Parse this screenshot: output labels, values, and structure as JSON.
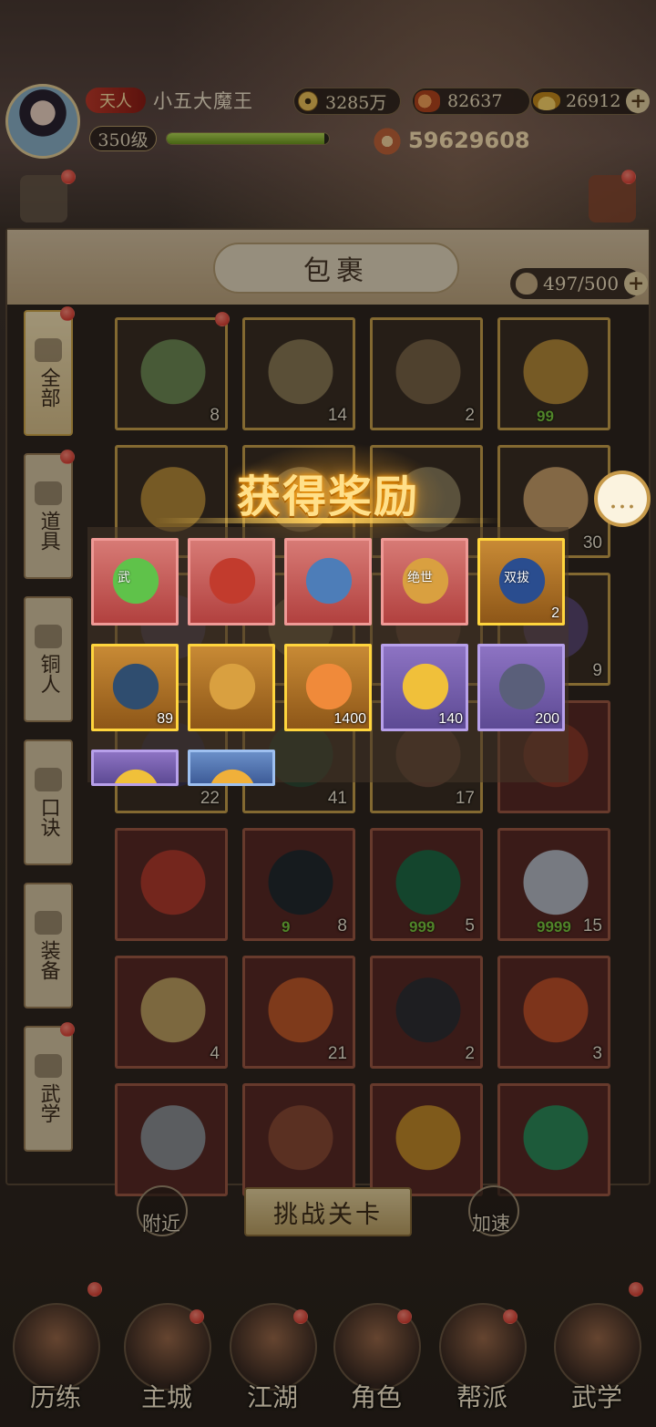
{
  "player": {
    "rank_badge": "天人",
    "name": "小五大魔王",
    "level": "350级",
    "xp_fraction": 0.97,
    "copper": "3285万",
    "stamina": "82637",
    "gold": "26912",
    "power": "59629608"
  },
  "bag": {
    "title": "包裹",
    "capacity": "497/500",
    "tabs": [
      {
        "label": "全部"
      },
      {
        "label": "道具"
      },
      {
        "label": "铜人"
      },
      {
        "label": "口诀"
      },
      {
        "label": "装备"
      },
      {
        "label": "武学"
      }
    ],
    "rows": [
      [
        {
          "count": "8"
        },
        {
          "count": "14"
        },
        {
          "count": "2"
        },
        {
          "count": "",
          "sub": "99"
        }
      ],
      [
        {
          "count": ""
        },
        {
          "count": ""
        },
        {
          "count": ""
        },
        {
          "count": "30"
        }
      ],
      [
        {
          "count": ""
        },
        {
          "count": ""
        },
        {
          "count": ""
        },
        {
          "count": "9"
        }
      ],
      [
        {
          "count": "22"
        },
        {
          "count": "41"
        },
        {
          "count": "17"
        },
        {
          "count": ""
        }
      ],
      [
        {
          "count": ""
        },
        {
          "count": "8",
          "sub": "9"
        },
        {
          "count": "5",
          "sub": "999"
        },
        {
          "count": "15",
          "sub": "9999"
        }
      ],
      [
        {
          "count": "4"
        },
        {
          "count": "21"
        },
        {
          "count": "2"
        },
        {
          "count": "3"
        }
      ],
      [
        {
          "count": ""
        },
        {
          "count": ""
        },
        {
          "count": ""
        },
        {
          "count": ""
        }
      ]
    ]
  },
  "reward": {
    "title": "获得奖励",
    "items": [
      {
        "count": "",
        "frame": "red",
        "tag": "武"
      },
      {
        "count": "",
        "frame": "red"
      },
      {
        "count": "",
        "frame": "red"
      },
      {
        "count": "",
        "frame": "red",
        "tag": "绝世"
      },
      {
        "count": "2",
        "frame": "gold",
        "tag": "双拔"
      },
      {
        "count": "89",
        "frame": "gold"
      },
      {
        "count": "",
        "frame": "gold"
      },
      {
        "count": "1400",
        "frame": "gold"
      },
      {
        "count": "140",
        "frame": "purple"
      },
      {
        "count": "200",
        "frame": "purple"
      },
      {
        "count": "",
        "frame": "purple"
      },
      {
        "count": "",
        "frame": "blue"
      }
    ]
  },
  "actions": {
    "challenge": "挑战关卡",
    "nearby": "附近",
    "speed": "加速"
  },
  "nav": [
    {
      "label": "历练"
    },
    {
      "label": "主城"
    },
    {
      "label": "江湖"
    },
    {
      "label": "角色"
    },
    {
      "label": "帮派"
    },
    {
      "label": "武学"
    }
  ],
  "colors": {
    "accent_gold": "#ffd53d",
    "red_dot": "#d2281c",
    "xp_green": "#8fc236"
  },
  "icons": {
    "copper": "coin-icon",
    "stamina": "stamina-icon",
    "gold": "gold-ingot-icon",
    "power": "power-icon",
    "chat": "chat-bubble-icon",
    "bag": "bag-icon"
  }
}
